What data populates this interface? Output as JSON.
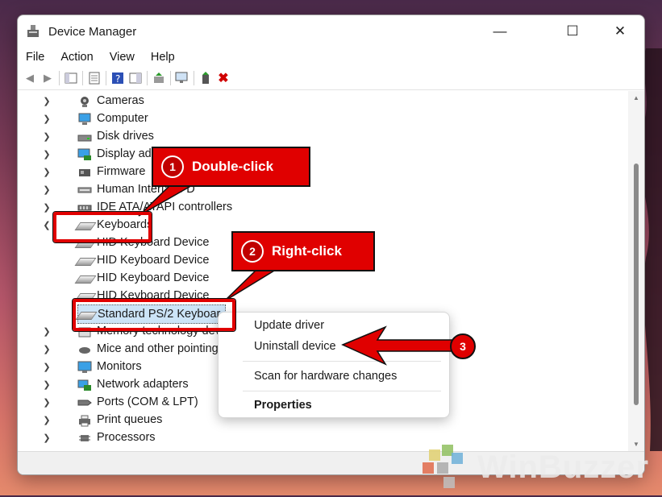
{
  "window": {
    "title": "Device Manager",
    "controls": {
      "minimize": "—",
      "maximize": "☐",
      "close": "✕"
    }
  },
  "menu": [
    "File",
    "Action",
    "View",
    "Help"
  ],
  "tree": {
    "items": [
      {
        "label": "Cameras",
        "icon": "camera-icon"
      },
      {
        "label": "Computer",
        "icon": "computer-icon"
      },
      {
        "label": "Disk drives",
        "icon": "disk-drive-icon"
      },
      {
        "label": "Display adapt",
        "icon": "display-adapter-icon"
      },
      {
        "label": "Firmware",
        "icon": "firmware-icon"
      },
      {
        "label": "Human Interface D",
        "icon": "hid-icon"
      },
      {
        "label": "IDE ATA/ATAPI controllers",
        "icon": "ide-controller-icon"
      },
      {
        "label": "Keyboards",
        "icon": "keyboard-icon"
      },
      {
        "label": "HID Keyboard Device",
        "icon": "keyboard-icon"
      },
      {
        "label": "HID Keyboard Device",
        "icon": "keyboard-icon"
      },
      {
        "label": "HID Keyboard Device",
        "icon": "keyboard-icon"
      },
      {
        "label": "HID Keyboard Device",
        "icon": "keyboard-icon"
      },
      {
        "label": "Standard PS/2 Keyboar",
        "icon": "keyboard-icon"
      },
      {
        "label": "Memory technology devic",
        "icon": "memory-icon"
      },
      {
        "label": "Mice and other pointing d",
        "icon": "mouse-icon"
      },
      {
        "label": "Monitors",
        "icon": "monitor-icon"
      },
      {
        "label": "Network adapters",
        "icon": "network-adapter-icon"
      },
      {
        "label": "Ports (COM & LPT)",
        "icon": "port-icon"
      },
      {
        "label": "Print queues",
        "icon": "printer-icon"
      },
      {
        "label": "Processors",
        "icon": "processor-icon"
      }
    ]
  },
  "context_menu": {
    "update": "Update driver",
    "uninstall": "Uninstall device",
    "scan": "Scan for hardware changes",
    "properties": "Properties"
  },
  "annotations": {
    "step1": {
      "num": "1",
      "text": "Double-click"
    },
    "step2": {
      "num": "2",
      "text": "Right-click"
    },
    "step3": {
      "num": "3"
    },
    "color": "#e00000"
  },
  "watermark": "WinBuzzer"
}
